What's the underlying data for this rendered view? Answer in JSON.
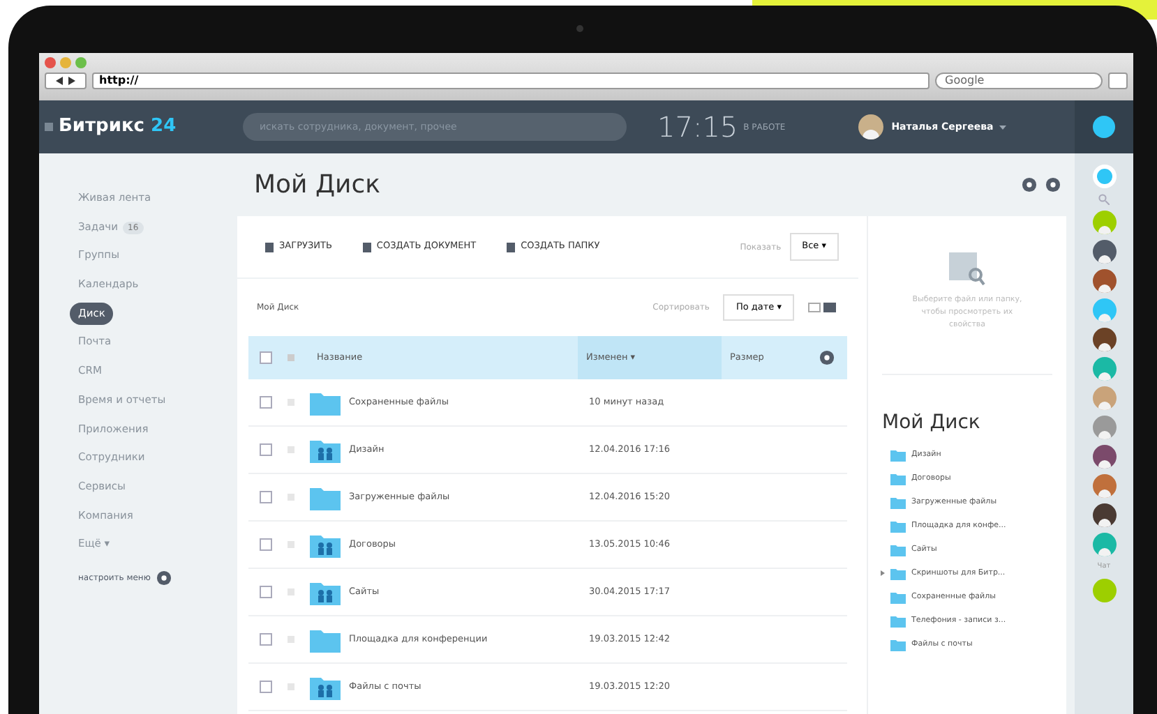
{
  "browser": {
    "url": "http://",
    "search_placeholder": "Google"
  },
  "header": {
    "logo": "Битрикс",
    "logo_number": "24",
    "search_placeholder": "искать сотрудника, документ, прочее",
    "time": "17:15",
    "work_status": "В РАБОТЕ",
    "user": "Наталья Сергеева"
  },
  "sidebar": {
    "items": [
      {
        "label": "Живая лента",
        "selected": false
      },
      {
        "label": "Задачи",
        "badge": "16",
        "selected": false
      },
      {
        "label": "Группы",
        "selected": false
      },
      {
        "label": "Календарь",
        "selected": false
      },
      {
        "label": "Диск",
        "selected": true
      },
      {
        "label": "Почта",
        "selected": false
      },
      {
        "label": "CRM",
        "selected": false
      },
      {
        "label": "Время и отчеты",
        "selected": false
      },
      {
        "label": "Приложения",
        "selected": false
      },
      {
        "label": "Сотрудники",
        "selected": false
      },
      {
        "label": "Сервисы",
        "selected": false
      },
      {
        "label": "Компания",
        "selected": false
      },
      {
        "label": "Ещё ▾",
        "selected": false
      }
    ],
    "settings": "настроить меню"
  },
  "page": {
    "title": "Мой Диск"
  },
  "toolbar": {
    "buttons": [
      "ЗАГРУЗИТЬ",
      "СОЗДАТЬ ДОКУМЕНТ",
      "СОЗДАТЬ ПАПКУ"
    ],
    "filter_label": "Показать",
    "filter_value": "Все ▾"
  },
  "breadcrumb": "Мой Диск",
  "sort": {
    "label": "Сортировать",
    "value": "По дате ▾"
  },
  "table": {
    "columns": [
      "Название",
      "Изменен ▾",
      "Размер"
    ],
    "all_checked": false,
    "rows": [
      {
        "name": "Сохраненные файлы",
        "modified": "10 минут назад",
        "kind": "plain",
        "checked": false
      },
      {
        "name": "Дизайн",
        "modified": "12.04.2016 17:16",
        "kind": "shared",
        "checked": false
      },
      {
        "name": "Загруженные файлы",
        "modified": "12.04.2016 15:20",
        "kind": "plain",
        "checked": false
      },
      {
        "name": "Договоры",
        "modified": "13.05.2015 10:46",
        "kind": "shared",
        "checked": false
      },
      {
        "name": "Сайты",
        "modified": "30.04.2015 17:17",
        "kind": "shared",
        "checked": false
      },
      {
        "name": "Площадка для конференции",
        "modified": "19.03.2015 12:42",
        "kind": "plain",
        "checked": false
      },
      {
        "name": "Файлы с почты",
        "modified": "19.03.2015 12:20",
        "kind": "shared",
        "checked": false
      }
    ]
  },
  "details": {
    "hint": "Выберите файл или папку, чтобы просмотреть их свойства",
    "title": "Мой Диск",
    "tree": [
      {
        "label": "Дизайн",
        "expandable": false
      },
      {
        "label": "Договоры",
        "expandable": false
      },
      {
        "label": "Загруженные файлы",
        "expandable": false
      },
      {
        "label": "Площадка для конфе...",
        "expandable": false
      },
      {
        "label": "Сайты",
        "expandable": false
      },
      {
        "label": "Скриншоты для Битр...",
        "expandable": true
      },
      {
        "label": "Сохраненные файлы",
        "expandable": false
      },
      {
        "label": "Телефония - записи з...",
        "expandable": false
      },
      {
        "label": "Файлы с почты",
        "expandable": false
      }
    ]
  },
  "chat_label": "Чат"
}
